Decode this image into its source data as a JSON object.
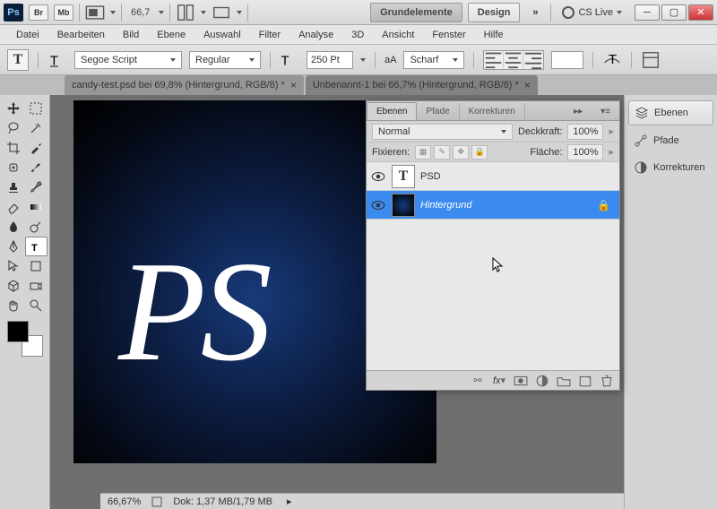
{
  "titlebar": {
    "zoom": "66,7",
    "workspaces": [
      "Grundelemente",
      "Design"
    ],
    "cs_live": "CS Live"
  },
  "menu": [
    "Datei",
    "Bearbeiten",
    "Bild",
    "Ebene",
    "Auswahl",
    "Filter",
    "Analyse",
    "3D",
    "Ansicht",
    "Fenster",
    "Hilfe"
  ],
  "optbar": {
    "font_family": "Segoe Script",
    "font_style": "Regular",
    "font_size": "250 Pt",
    "aa_label": "aA",
    "aa_mode": "Scharf"
  },
  "docs": [
    {
      "title": "candy-test.psd bei 69,8% (Hintergrund, RGB/8) *",
      "active": false
    },
    {
      "title": "Unbenannt-1 bei 66,7% (Hintergrund, RGB/8) *",
      "active": true
    }
  ],
  "canvas_text": "PS",
  "status": {
    "zoom": "66,67%",
    "doc": "Dok: 1,37 MB/1,79 MB"
  },
  "dock": {
    "items": [
      "Ebenen",
      "Pfade",
      "Korrekturen"
    ]
  },
  "panel": {
    "tabs": [
      "Ebenen",
      "Pfade",
      "Korrekturen"
    ],
    "blend": "Normal",
    "opacity_label": "Deckkraft:",
    "opacity": "100%",
    "lock_label": "Fixieren:",
    "fill_label": "Fläche:",
    "fill": "100%",
    "layers": [
      {
        "name": "PSD",
        "type": "text"
      },
      {
        "name": "Hintergrund",
        "type": "bg",
        "selected": true,
        "locked": true
      }
    ]
  }
}
